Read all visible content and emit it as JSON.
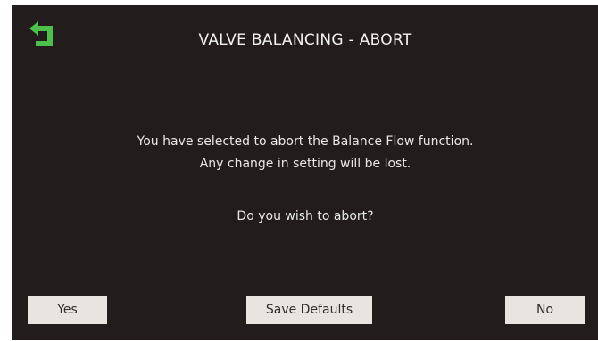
{
  "header": {
    "title": "VALVE BALANCING - ABORT",
    "back_icon": "back-arrow-icon",
    "back_icon_color": "#4cc04a"
  },
  "dialog": {
    "line1": "You have selected to abort the Balance Flow function.",
    "line2": "Any change in setting will be lost.",
    "question": "Do you wish to abort?"
  },
  "buttons": {
    "yes_label": "Yes",
    "save_defaults_label": "Save Defaults",
    "no_label": "No"
  },
  "colors": {
    "background": "#221d1c",
    "button_bg": "#e9e4df",
    "text": "#f2f2f2"
  }
}
